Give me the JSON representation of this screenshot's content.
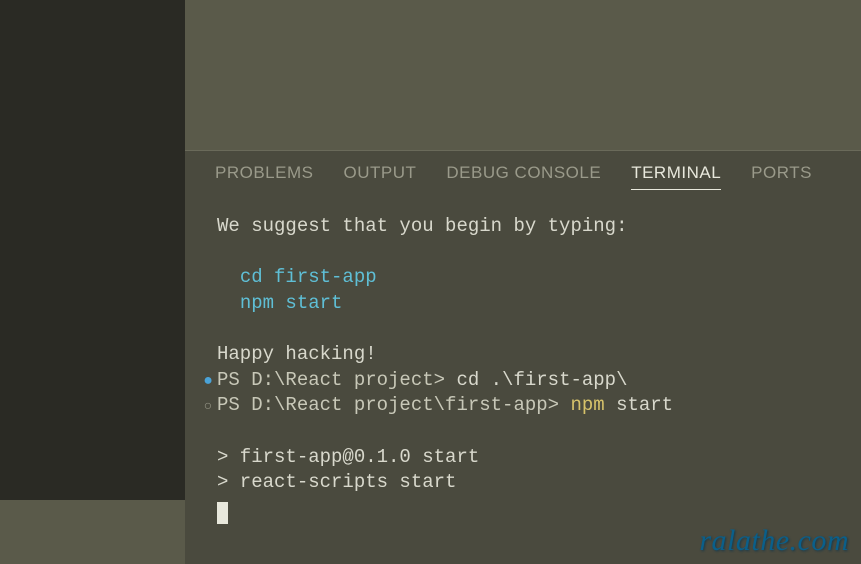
{
  "tabs": {
    "problems": "PROBLEMS",
    "output": "OUTPUT",
    "debug": "DEBUG CONSOLE",
    "terminal": "TERMINAL",
    "ports": "PORTS"
  },
  "terminal": {
    "suggest": "We suggest that you begin by typing:",
    "cd_cmd": "cd first-app",
    "npm_cmd": "npm start",
    "happy": "Happy hacking!",
    "prompt1": "PS D:\\React project> ",
    "prompt1_cmd": "cd .\\first-app\\",
    "prompt2": "PS D:\\React project\\first-app> ",
    "prompt2_cmd_yellow": "npm ",
    "prompt2_cmd_rest": "start",
    "out1": "> first-app@0.1.0 start",
    "out2": "> react-scripts start"
  },
  "watermark": "ralathe.com"
}
